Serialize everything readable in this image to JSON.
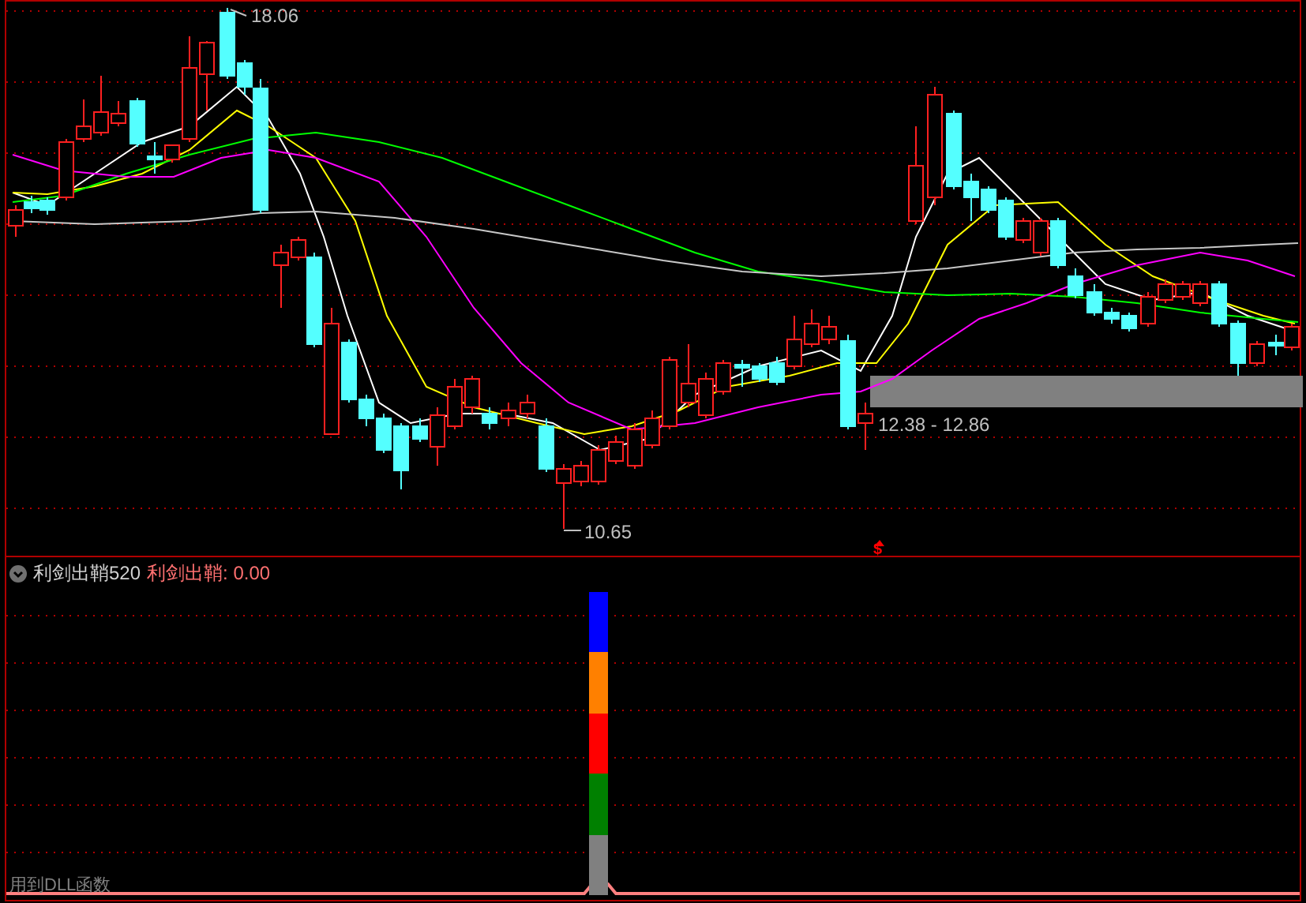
{
  "main_chart": {
    "high_label": "18.06",
    "low_label": "10.65",
    "range_label": "12.38 - 12.86",
    "signal_mark": "$"
  },
  "indicator": {
    "name": "利剑出鞘520",
    "value_label": "利剑出鞘: 0.00",
    "segments": [
      {
        "color": "#0000ff"
      },
      {
        "color": "#ff8000"
      },
      {
        "color": "#ff0000"
      },
      {
        "color": "#008000"
      },
      {
        "color": "#808080"
      }
    ]
  },
  "footer": "用到DLL函数"
}
